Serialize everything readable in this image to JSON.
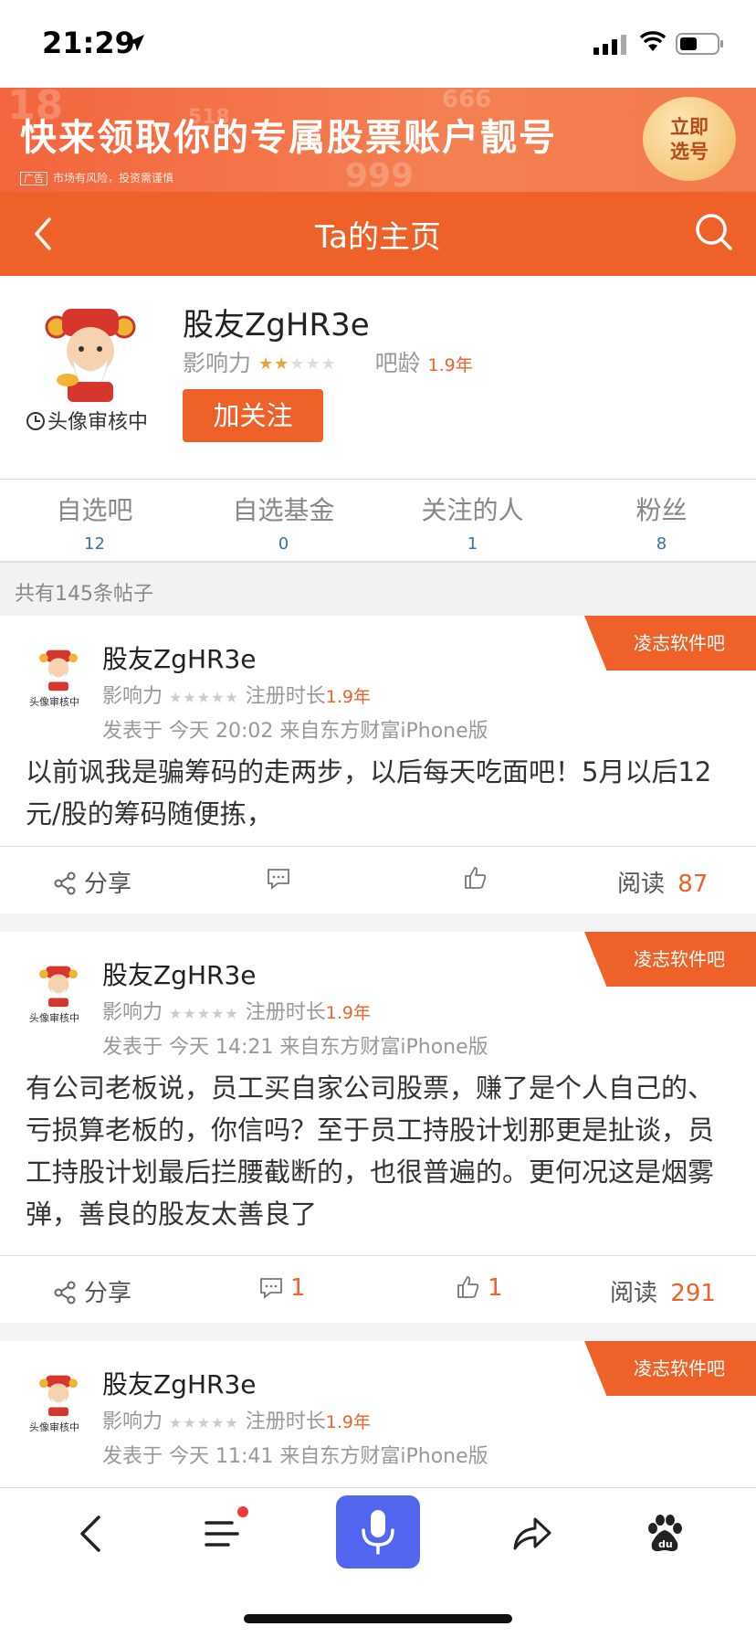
{
  "status_bar": {
    "time": "21:29"
  },
  "ad": {
    "title": "快来领取你的专属股票账户靓号",
    "tag_box": "广告",
    "tag_text": "市场有风险，投资需谨慎",
    "button_line1": "立即",
    "button_line2": "选号",
    "deco_numbers": [
      "18",
      "518",
      "666",
      "999"
    ]
  },
  "header": {
    "title": "Ta的主页"
  },
  "profile": {
    "name": "股友ZgHR3e",
    "avatar_status": "头像审核中",
    "influence_label": "影响力",
    "influence_stars_on": 2,
    "bar_age_label": "吧龄",
    "bar_age_value": "1.9年",
    "follow_button": "加关注"
  },
  "stats": [
    {
      "label": "自选吧",
      "value": "12"
    },
    {
      "label": "自选基金",
      "value": "0"
    },
    {
      "label": "关注的人",
      "value": "1"
    },
    {
      "label": "粉丝",
      "value": "8"
    }
  ],
  "post_count": "共有145条帖子",
  "posts": [
    {
      "tag": "凌志软件吧",
      "author": "股友ZgHR3e",
      "avatar_status": "头像审核中",
      "influence_label": "影响力",
      "reg_label": "注册时长",
      "reg_value": "1.9年",
      "time_text": "发表于  今天 20:02   来自东方财富iPhone版",
      "content": "以前讽我是骗筹码的走两步，以后每天吃面吧！5月以后12元/股的筹码随便拣，",
      "share_label": "分享",
      "comments": "",
      "likes": "",
      "read_label": "阅读",
      "reads": "87"
    },
    {
      "tag": "凌志软件吧",
      "author": "股友ZgHR3e",
      "avatar_status": "头像审核中",
      "influence_label": "影响力",
      "reg_label": "注册时长",
      "reg_value": "1.9年",
      "time_text": "发表于  今天 14:21   来自东方财富iPhone版",
      "content": "有公司老板说，员工买自家公司股票，赚了是个人自己的、亏损算老板的，你信吗？至于员工持股计划那更是扯谈，员工持股计划最后拦腰截断的，也很普遍的。更何况这是烟雾弹，善良的股友太善良了",
      "share_label": "分享",
      "comments": "1",
      "likes": "1",
      "read_label": "阅读",
      "reads": "291"
    },
    {
      "tag": "凌志软件吧",
      "author": "股友ZgHR3e",
      "avatar_status": "头像审核中",
      "influence_label": "影响力",
      "reg_label": "注册时长",
      "reg_value": "1.9年",
      "time_text": "发表于  今天 11:41   来自东方财富iPhone版"
    }
  ],
  "colors": {
    "accent": "#ee6128",
    "stat_num": "#3a6fb0",
    "mic": "#5266f0"
  },
  "bottom_bar": [
    "back-icon",
    "menu-icon",
    "mic-icon",
    "share-icon",
    "baidu-icon"
  ]
}
